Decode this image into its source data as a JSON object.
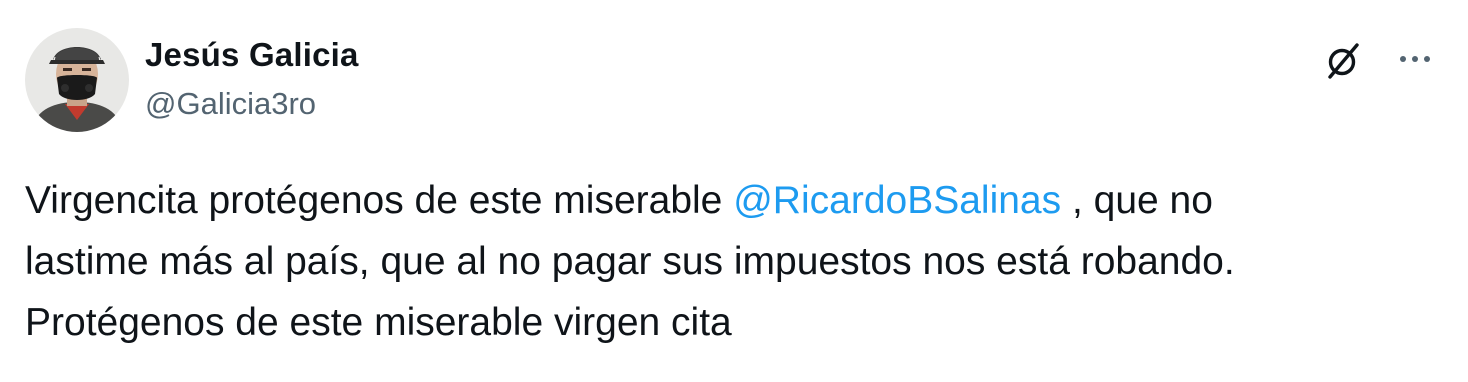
{
  "author": {
    "display_name": "Jesús Galicia",
    "handle": "@Galicia3ro",
    "avatar_icon": "user-avatar-photo"
  },
  "actions": {
    "grok_icon": "grok-icon",
    "more_icon": "more-options-icon"
  },
  "tweet": {
    "line1_before": "Virgencita protégenos de este miserable ",
    "mention": "@RicardoBSalinas",
    "line1_after": " , que no",
    "line2": "lastime más al país, que al no pagar sus impuestos nos está robando.",
    "line3": "Protégenos de este miserable virgen cita"
  },
  "colors": {
    "text": "#0f1419",
    "secondary": "#536471",
    "link": "#1d9bf0"
  }
}
